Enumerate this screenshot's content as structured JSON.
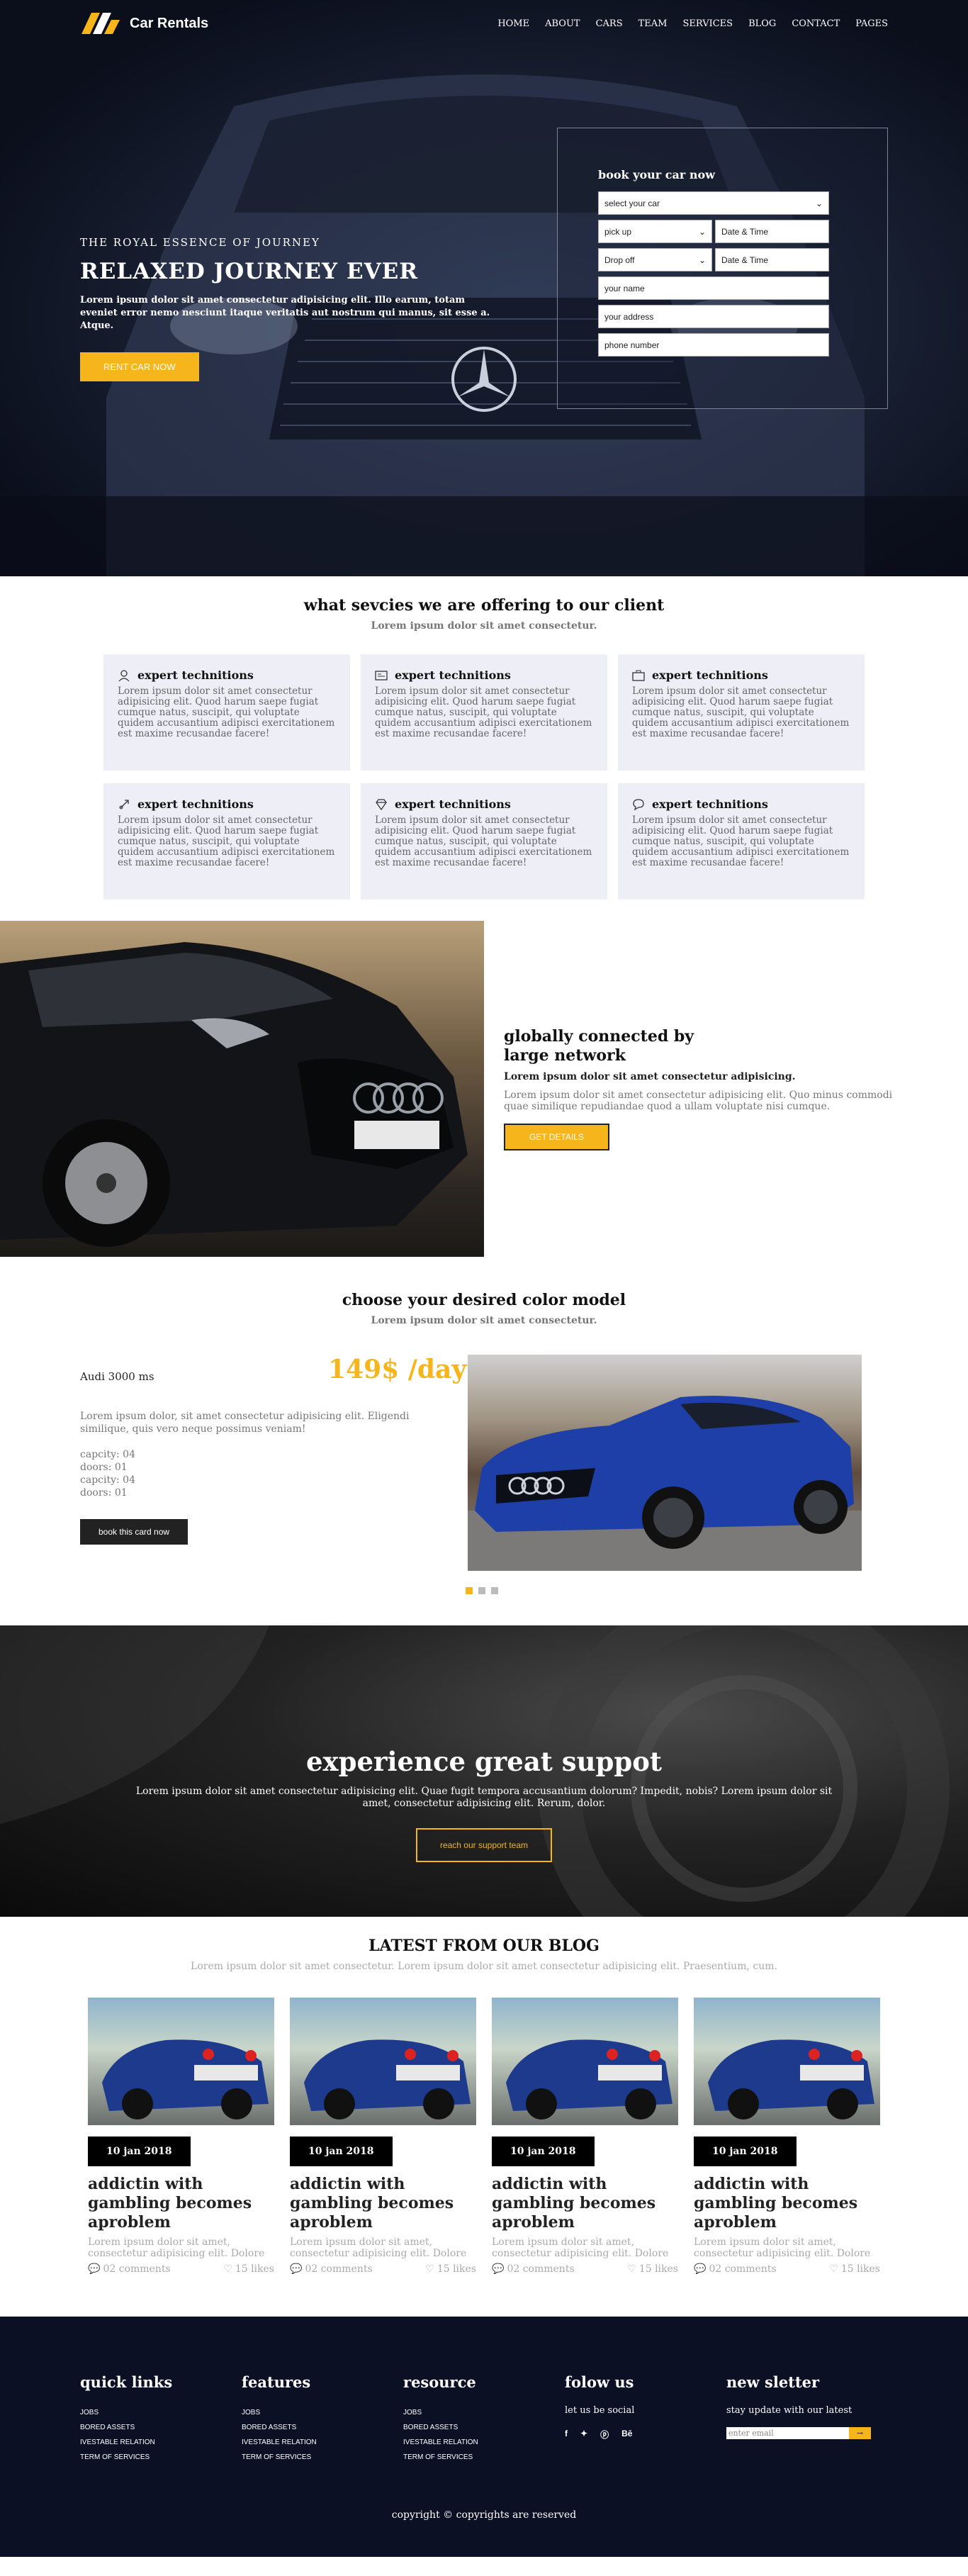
{
  "header": {
    "brand": "Car Rentals",
    "menu": [
      "HOME",
      "ABOUT",
      "CARS",
      "TEAM",
      "SERVICES",
      "BLOG",
      "CONTACT",
      "PAGES"
    ]
  },
  "hero": {
    "subtitle": "THE  ROYAL  ESSENCE  OF  JOURNEY",
    "title": "RELAXED JOURNEY EVER",
    "description": "Lorem ipsum dolor sit amet consectetur adipisicing elit. Illo earum, totam eveniet error nemo nesciunt itaque veritatis aut nostrum qui manus, sit esse a. Atque.",
    "button": "RENT CAR NOW"
  },
  "booking": {
    "title": "book your car now",
    "select_car": "select your car",
    "pickup": "pick up",
    "pickup_date": "Date & Time",
    "dropoff": "Drop off",
    "dropoff_date": "Date & Time",
    "name": "your name",
    "address": "your address",
    "phone": "phone number"
  },
  "services": {
    "title": "what sevcies we are offering to our client",
    "subtitle": "Lorem ipsum dolor sit amet consectetur.",
    "items": [
      {
        "icon": "user-icon",
        "title": "expert technitions",
        "text": "Lorem ipsum dolor sit amet consectetur adipisicing elit. Quod harum saepe fugiat cumque natus, suscipit, qui voluptate quidem accusantium adipisci exercitationem est maxime recusandae facere!"
      },
      {
        "icon": "id-card-icon",
        "title": "expert technitions",
        "text": "Lorem ipsum dolor sit amet consectetur adipisicing elit. Quod harum saepe fugiat cumque natus, suscipit, qui voluptate quidem accusantium adipisci exercitationem est maxime recusandae facere!"
      },
      {
        "icon": "briefcase-icon",
        "title": "expert technitions",
        "text": "Lorem ipsum dolor sit amet consectetur adipisicing elit. Quod harum saepe fugiat cumque natus, suscipit, qui voluptate quidem accusantium adipisci exercitationem est maxime recusandae facere!"
      },
      {
        "icon": "rocket-icon",
        "title": "expert technitions",
        "text": "Lorem ipsum dolor sit amet consectetur adipisicing elit. Quod harum saepe fugiat cumque natus, suscipit, qui voluptate quidem accusantium adipisci exercitationem est maxime recusandae facere!"
      },
      {
        "icon": "diamond-icon",
        "title": "expert technitions",
        "text": "Lorem ipsum dolor sit amet consectetur adipisicing elit. Quod harum saepe fugiat cumque natus, suscipit, qui voluptate quidem accusantium adipisci exercitationem est maxime recusandae facere!"
      },
      {
        "icon": "chat-icon",
        "title": "expert technitions",
        "text": "Lorem ipsum dolor sit amet consectetur adipisicing elit. Quod harum saepe fugiat cumque natus, suscipit, qui voluptate quidem accusantium adipisci exercitationem est maxime recusandae facere!"
      }
    ]
  },
  "global": {
    "title_line1": "globally connected by",
    "title_line2": "large network",
    "bold": "Lorem ipsum dolor sit amet consectetur adipisicing.",
    "text": "Lorem ipsum dolor sit amet consectetur adipisicing elit. Quo minus commodi quae similique repudiandae quod a ullam voluptate nisi cumque.",
    "button": "GET DETAILS"
  },
  "model": {
    "title": "choose your desired color model",
    "subtitle": "Lorem ipsum dolor sit amet consectetur.",
    "name": "Audi 3000 ms",
    "price": "149$ /day",
    "description": "Lorem ipsum dolor, sit amet consectetur adipisicing elit. Eligendi similique, quis vero neque possimus veniam!",
    "specs": [
      "capcity: 04",
      "doors: 01",
      "capcity: 04",
      "doors: 01"
    ],
    "button": "book this card now"
  },
  "support": {
    "title": "experience great suppot",
    "text": "Lorem ipsum dolor sit amet consectetur adipisicing elit. Quae fugit tempora accusantium dolorum? Impedit, nobis? Lorem ipsum dolor sit amet, consectetur adipisicing elit. Rerum, dolor.",
    "button": "reach our support team"
  },
  "blog": {
    "title": "LATEST FROM OUR BLOG",
    "subtitle": "Lorem ipsum dolor sit amet consectetur. Lorem ipsum dolor sit amet consectetur adipisicing elit. Praesentium, cum.",
    "posts": [
      {
        "date": "10 jan 2018",
        "title": "addictin with gambling becomes aproblem",
        "excerpt": "Lorem ipsum dolor sit amet, consectetur adipisicing elit. Dolore",
        "comments": "02 comments",
        "likes": "15 likes"
      },
      {
        "date": "10 jan 2018",
        "title": "addictin with gambling becomes aproblem",
        "excerpt": "Lorem ipsum dolor sit amet, consectetur adipisicing elit. Dolore",
        "comments": "02 comments",
        "likes": "15 likes"
      },
      {
        "date": "10 jan 2018",
        "title": "addictin with gambling becomes aproblem",
        "excerpt": "Lorem ipsum dolor sit amet, consectetur adipisicing elit. Dolore",
        "comments": "02 comments",
        "likes": "15 likes"
      },
      {
        "date": "10 jan 2018",
        "title": "addictin with gambling becomes aproblem",
        "excerpt": "Lorem ipsum dolor sit amet, consectetur adipisicing elit. Dolore",
        "comments": "02 comments",
        "likes": "15 likes"
      }
    ]
  },
  "footer": {
    "quick_links": {
      "title": "quick links",
      "items": [
        "JOBS",
        "BORED ASSETS",
        "IVESTABLE RELATION",
        "TERM OF SERVICES"
      ]
    },
    "features": {
      "title": "features",
      "items": [
        "JOBS",
        "BORED ASSETS",
        "IVESTABLE RELATION",
        "TERM OF SERVICES"
      ]
    },
    "resource": {
      "title": "resource",
      "items": [
        "JOBS",
        "BORED ASSETS",
        "IVESTABLE RELATION",
        "TERM OF SERVICES"
      ]
    },
    "follow": {
      "title": "folow us",
      "text": "let us be social",
      "icons": [
        "f",
        "✦",
        "ⓟ",
        "Bē"
      ]
    },
    "newsletter": {
      "title": "new sletter",
      "text": "stay update with our latest",
      "placeholder": "enter email",
      "button": "→"
    },
    "copyright": "copyright © copyrights are reserved"
  },
  "colors": {
    "accent": "#f5b51b",
    "footer_bg": "#0b1024",
    "card_bg": "#eeeef7"
  }
}
